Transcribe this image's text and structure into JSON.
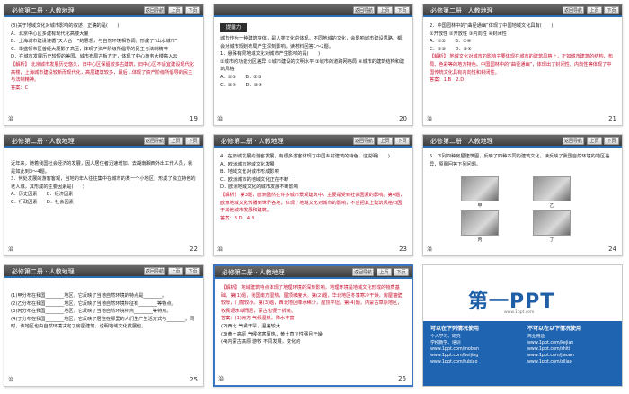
{
  "slides": [
    {
      "title": "必修第二册 · 人教地理",
      "nav": [
        "返回导航",
        "上页",
        "下页"
      ],
      "footer": "治",
      "number": "19",
      "lines": [
        "(3)关于地域文化对城市影响的叙述，正确的是(　　)",
        "A．北京中心区多建有现代化高楼大厦",
        "B．上海城市建设遵循“天人合一”的思想，与自然环境相协调，形成了“山水城市”",
        "C．华盛顿市区曾经大厦影子高压，体现了资产阶级所倡导的民主与法制精神",
        "D．在城市发展历史较短的美国，城市布局古板方正，体现了中心商务大楼高入云"
      ],
      "answer_lines": [
        "【解析】 北京城市发展历史悠久，旧中心区保留较多古建筑，旧中心区不适宜建设现代化高楼，上海城市建设较新而现代化，高层建筑较多，最后…体现了资产阶级所倡导的民主与法制精神。",
        "答案：C"
      ]
    },
    {
      "title": "",
      "nav": [
        "返回导航",
        "上页",
        "下页"
      ],
      "footer": "治",
      "number": "20",
      "badge": "提能力",
      "lines": [
        "城市作为一种建筑实体，是人类文化的体现，不同地域的文化，会影响城市建设思路。都会对城市规划布局产生深刻影响。读材料回答1～2题。",
        "1．悬殊有限地域文化对城市产生影响的是(　　)",
        "①城市的功能分区差异 ②城市建设的文明水平 ③城市的道路网格局 ④城市的建筑结构和建筑风格",
        "A．①②　　B．②③",
        "C．②④　　D．③④"
      ]
    },
    {
      "title": "必修第二册 · 人教地理",
      "nav": [
        "返回导航",
        "上页",
        "下页"
      ],
      "footer": "治",
      "number": "21",
      "lines": [
        "2．中国园林中的“曲径通幽”体现了中国地域文化具有(　　)",
        "①开放性 ②开放性 ③内向性 ④封闭性",
        "A．①②　　B．①④",
        "C．②③　　D．③④"
      ],
      "answer_lines": [
        "【解析】 地域文化对城市的影响主要体现在城市的建筑风格上，正如城市建筑的结构、布局、色彩等的地方特色。中国园林中的“曲径通幽”，体现出了封闭性、内向性等体现了中国传统文化具有内向性和封闭性。",
        "答案：1.B　2.D"
      ]
    },
    {
      "title": "必修第二册 · 人教地理",
      "nav": [
        "返回导航",
        "上页",
        "下页"
      ],
      "footer": "治",
      "number": "22",
      "lines": [
        "近年来，随着我国社会经济的发展，因人居住者迅速增加，去湖南湘西外出工作人员，就是如此到3～4题。",
        "3．何处发展的游客客观，当地的年人往往集中在城市的某一个小地区，形成了独立特色的老人城，其形成的主要因素是(　　)",
        "A．历史因素　　B．经济因素",
        "C．行政因素　　D．社会因素"
      ]
    },
    {
      "title": "必修第二册 · 人教地理",
      "nav": [
        "返回导航",
        "上页",
        "下页"
      ],
      "footer": "治",
      "number": "23",
      "lines": [
        "4．在旧城发展的游客发展，有很多游客体现了中国乡村建筑的特色，这说明(　　)",
        "A．欧洲城市地域文化发展",
        "B．地域文化对城市形成影响",
        "C．欧洲城市的地域文化正在不断",
        "D．欧洲地域文化的城市发展不断影响"
      ],
      "answer_lines": [
        "【解析】 第3题，欧洲固然在许多城市景观建筑中，主要是受到社会因素的影响。第4题，欧洲地域文化传播到世界各地，体现了地域文化对城市的影响，不应把其上建筑风格归因于其他城市发展和建筑。",
        "答案：3.D　4.B"
      ]
    },
    {
      "title": "必修第二册 · 人教地理",
      "nav": [
        "返回导航",
        "上页",
        "下页"
      ],
      "footer": "治",
      "number": "24",
      "lines": [
        "5．下列四种房屋建筑图，反映了四种不同的建筑文化。读反映了我国自然环境的地区差异，原图回答下列问题。"
      ],
      "photos": [
        "甲",
        "乙",
        "丙",
        "丁"
      ]
    },
    {
      "title": "必修第二册 · 人教地理",
      "nav": [
        "返回导航",
        "上页",
        "下页"
      ],
      "footer": "治",
      "number": "25",
      "lines": [
        "(1)甲分布在我国________地区，它反映了当地自然环境的特点是________。",
        "(2)乙分布在我国________地区，它反映了当地自然环境特征有________等特点。",
        "(3)丙分布在我国________地区，它反映了当地自然环境特点________等特点。",
        "(4)丁分布在我国________地区，它反映了居住在那里的人们生产生活方式与________。同时，该地区也由自然环境决定了房屋建筑，说明地域文化发展也。"
      ]
    },
    {
      "title": "必修第二册 · 人教地理",
      "nav": [
        "返回导航",
        "上页",
        "下页"
      ],
      "footer": "治",
      "number": "26",
      "lines": [],
      "answer_lines": [
        "【解析】 地域建筑特点体现了地理环境的深刻影响，地理环境是地域文化形成的物质基础。第(1)题，我国南方湿热，屋顶坡度大。第(2)题，华北地区冬季寒冷干燥，房屋墙壁较厚，门窗较小。第(3)题，西北地区降水稀少，屋顶平坦。第(4)题，内蒙古草原地区，牧民逐水草而居，蒙古包便于拆装。",
        "答案：(1)南方 气候湿热，降水丰富",
        "(2)西北 气候干旱，温差较大",
        "(3)黄土高原 气候冬寒夏热，黄土直立性强且干燥",
        "(4)内蒙古高原 游牧 不同发展，变化的"
      ]
    }
  ],
  "ad": {
    "logo": "第一PPT",
    "logo_sub": "www.1ppt.com",
    "left_title": "可以在下列情况使用",
    "left_lines": [
      "个人学习、研究",
      "学校教学、培训",
      "www.1ppt.com/moban",
      "www.1ppt.com/beijing",
      "www.1ppt.com/tubiao"
    ],
    "right_title": "不可以在以下情况使用",
    "right_lines": [
      "商业用途",
      "www.1ppt.com/kejian",
      "www.1ppt.com/shiti",
      "www.1ppt.com/jiaoan",
      "www.1ppt.com/ziliao"
    ]
  }
}
